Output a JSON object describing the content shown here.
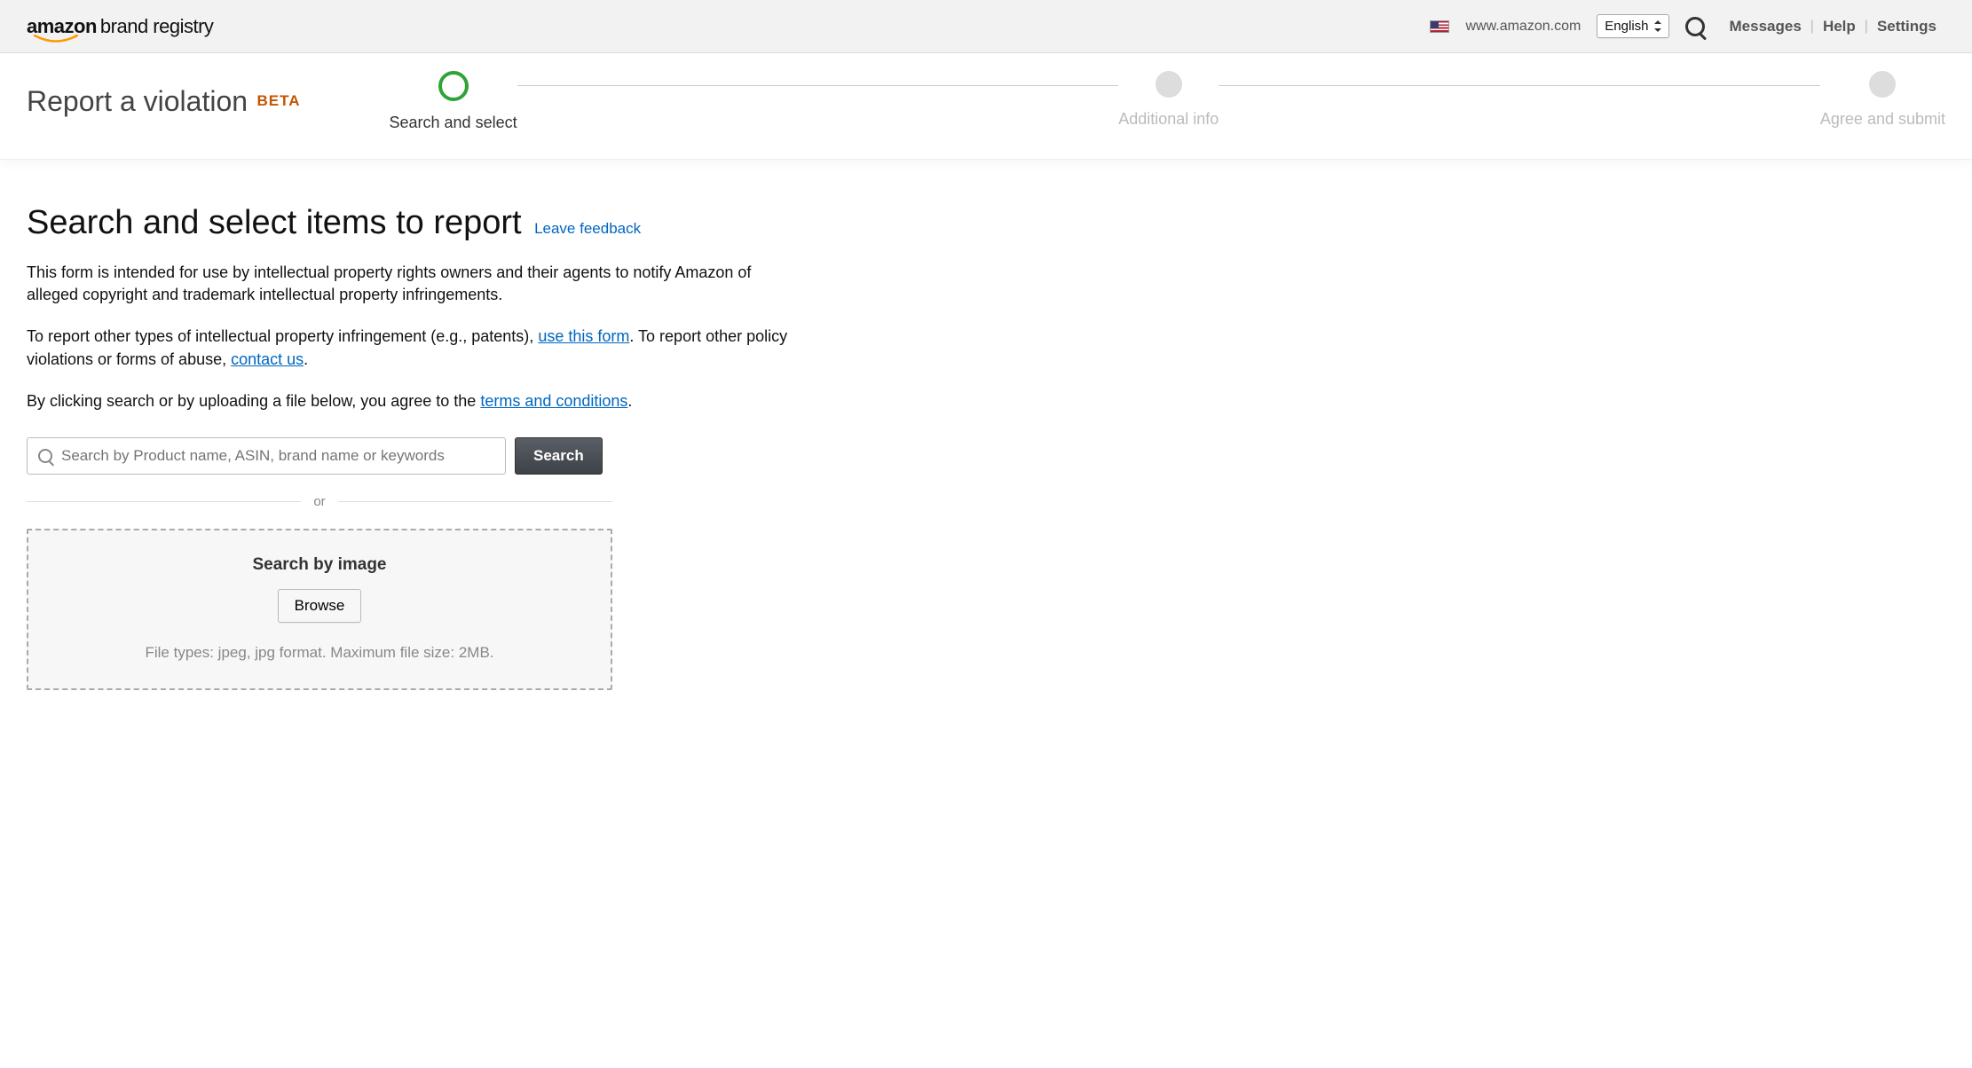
{
  "header": {
    "logo_primary": "amazon",
    "logo_secondary": "brand registry",
    "domain": "www.amazon.com",
    "language": "English",
    "nav": {
      "messages": "Messages",
      "help": "Help",
      "settings": "Settings"
    }
  },
  "subheader": {
    "title": "Report a violation",
    "badge": "BETA",
    "steps": [
      {
        "label": "Search and select",
        "active": true
      },
      {
        "label": "Additional info",
        "active": false
      },
      {
        "label": "Agree and submit",
        "active": false
      }
    ]
  },
  "main": {
    "heading": "Search and select items to report",
    "feedback": "Leave feedback",
    "p1": "This form is intended for use by intellectual property rights owners and their agents to notify Amazon of alleged copyright and trademark intellectual property infringements.",
    "p2a": "To report other types of intellectual property infringement (e.g., patents), ",
    "p2_link1": "use this form",
    "p2b": ". To report other policy violations or forms of abuse, ",
    "p2_link2": "contact us",
    "p2c": ".",
    "p3a": "By clicking search or by uploading a file below, you agree to the ",
    "p3_link": "terms and conditions",
    "p3b": ".",
    "search_placeholder": "Search by Product name, ASIN, brand name or keywords",
    "search_button": "Search",
    "or": "or",
    "dropzone_title": "Search by image",
    "browse": "Browse",
    "dropzone_hint": "File types: jpeg, jpg format. Maximum file size: 2MB."
  }
}
